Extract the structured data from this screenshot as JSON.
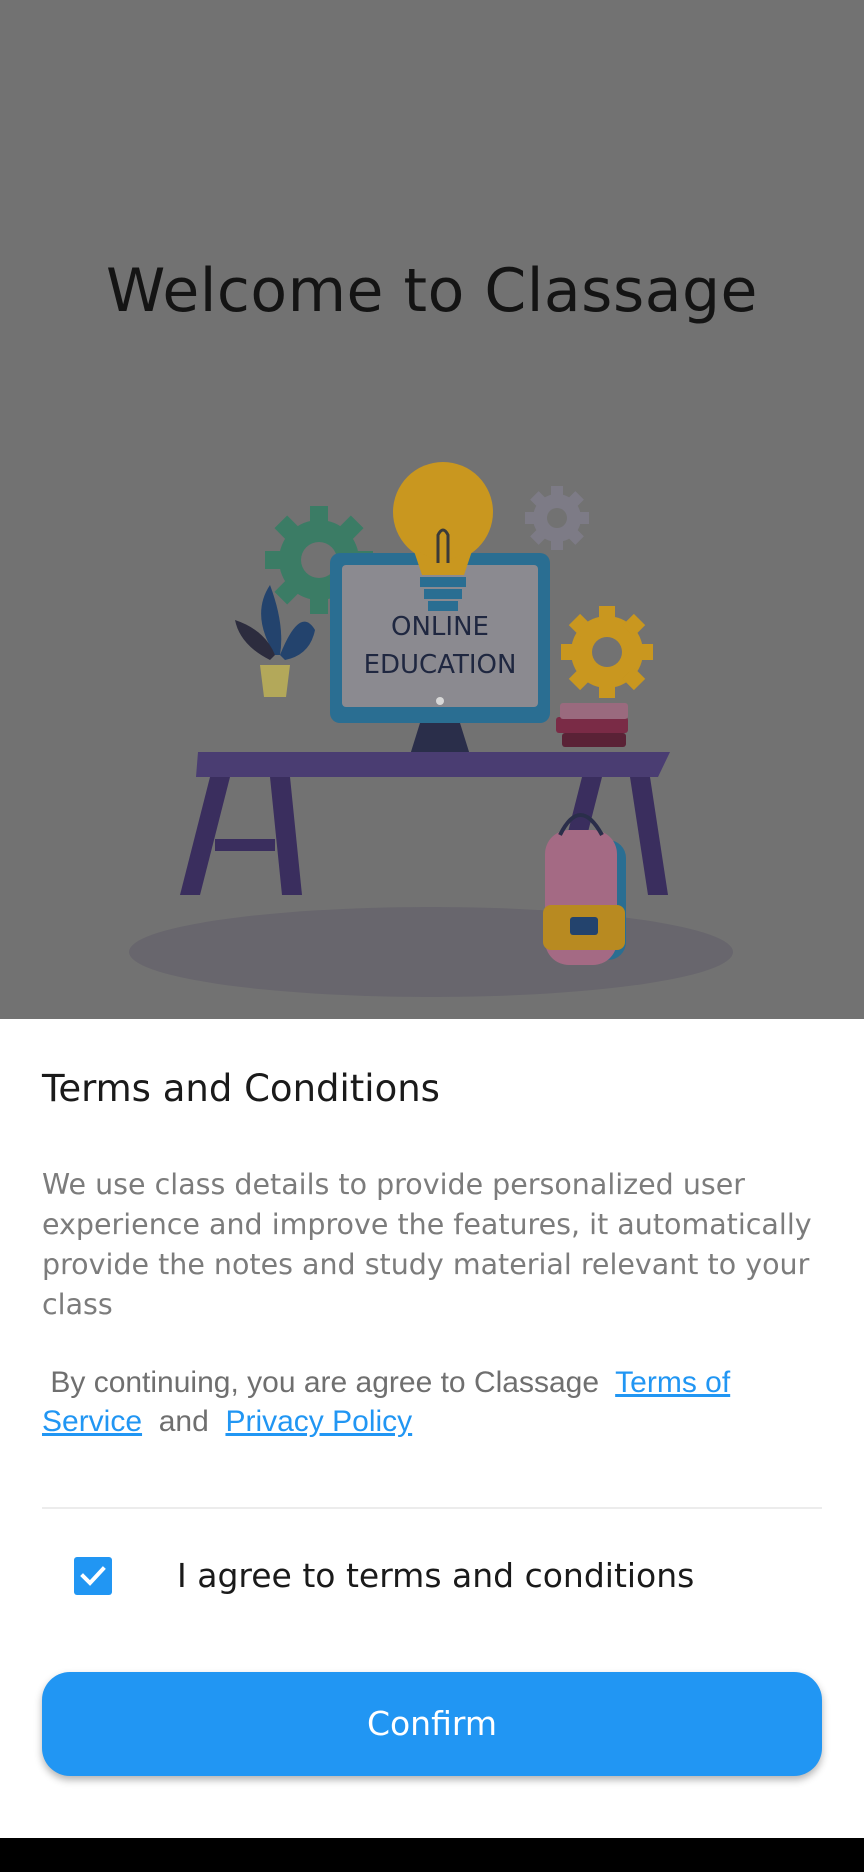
{
  "welcome": {
    "title": "Welcome to Classage"
  },
  "illustration": {
    "screen_text_line1": "ONLINE",
    "screen_text_line2": "EDUCATION"
  },
  "terms": {
    "title": "Terms and Conditions",
    "description": "We use class details to provide personalized user experience and improve the features, it automatically provide the notes and study material relevant to your class",
    "consent_prefix": "By continuing, you are agree to Classage",
    "terms_link": "Terms of Service",
    "and_text": "and",
    "privacy_link": "Privacy Policy",
    "checkbox_checked": true,
    "checkbox_label": "I agree to terms and conditions",
    "confirm_label": "Confirm"
  },
  "colors": {
    "accent": "#2196f3",
    "overlay": "#727272"
  }
}
